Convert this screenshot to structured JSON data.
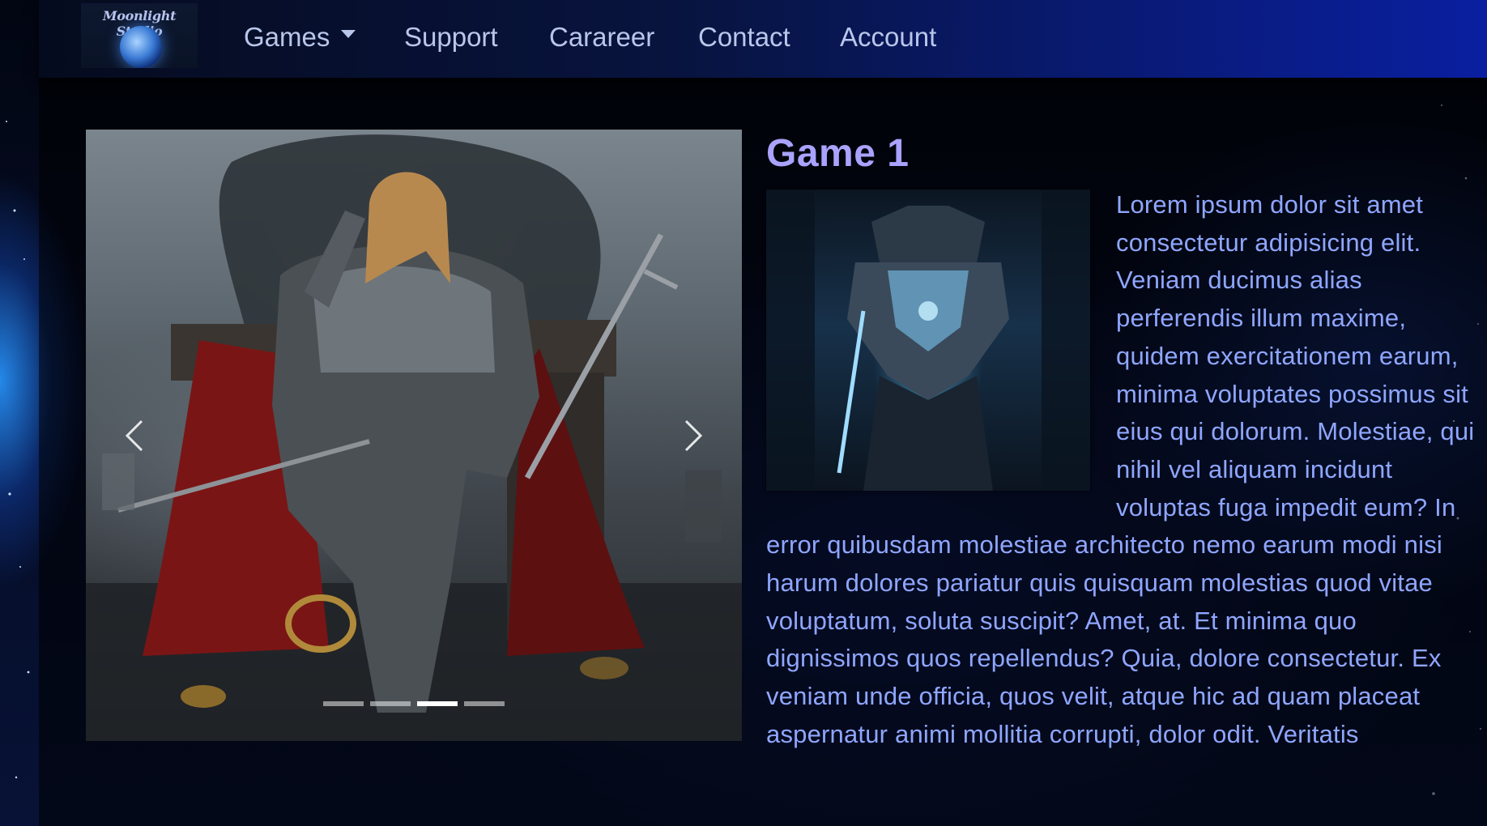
{
  "brand": {
    "name": "Moonlight Studio"
  },
  "nav": {
    "items": [
      {
        "label": "Games",
        "has_dropdown": true
      },
      {
        "label": "Support"
      },
      {
        "label": "Carareer"
      },
      {
        "label": "Contact"
      },
      {
        "label": "Account"
      }
    ]
  },
  "carousel": {
    "slide_count": 4,
    "active_index": 2,
    "prev_icon": "chevron-left-icon",
    "next_icon": "chevron-right-icon"
  },
  "article": {
    "title": "Game 1",
    "body": "Lorem ipsum dolor sit amet consectetur adipisicing elit. Veniam ducimus alias perferendis illum maxime, quidem exercitationem earum, minima voluptates possimus sit eius qui dolorum. Molestiae, qui nihil vel aliquam incidunt voluptas fuga impedit eum? In error quibusdam molestiae architecto nemo earum modi nisi harum dolores pariatur quis quisquam molestias quod vitae voluptatum, soluta suscipit? Amet, at. Et minima quo dignissimos quos repellendus? Quia, dolore consectetur. Ex veniam unde officia, quos velit, atque hic ad quam placeat aspernatur animi mollitia corrupti, dolor odit. Veritatis"
  },
  "colors": {
    "title": "#a9a3ff",
    "body_text": "#8fa6ff",
    "nav_text": "#b9c6ea",
    "nav_gradient_end": "#0a1fa0"
  }
}
